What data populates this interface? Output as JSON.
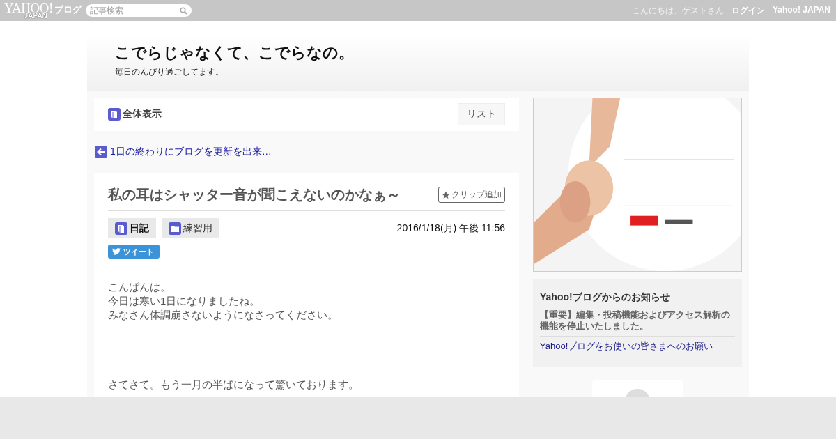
{
  "top_bar": {
    "logo": {
      "wordmark": "YAHOO!",
      "sub": "JAPAN",
      "service": "ブログ"
    },
    "search": {
      "placeholder": "記事検索"
    },
    "greeting": "こんにちは、ゲストさん",
    "links": [
      "ログイン",
      "Yahoo! JAPAN"
    ]
  },
  "blog": {
    "title": "こでらじゃなくて、こでらなの。",
    "subtitle": "毎日のんびり過ごしてます。"
  },
  "view_bar": {
    "label": "全体表示",
    "list_button": "リスト"
  },
  "prev_link": "1日の終わりにブログを更新を出来…",
  "article": {
    "title": "私の耳はシャッター音が聞こえないのかなぁ～",
    "clip_button": "クリップ追加",
    "tags": [
      {
        "kind": "book",
        "label": "日記"
      },
      {
        "kind": "folder",
        "label": "練習用"
      }
    ],
    "date": "2016/1/18(月) 午後 11:56",
    "tweet": "ツイート",
    "paragraphs": [
      [
        "こんばんは。",
        "今日は寒い1日になりましたね。",
        "みなさん体調崩さないようになさってください。"
      ],
      [
        "さてさて。もう一月の半ばになって驚いております。"
      ]
    ]
  },
  "sidebar": {
    "notice": {
      "title": "Yahoo!ブログからのお知らせ",
      "items": [
        {
          "kind": "important",
          "text": "【重要】編集・投稿機能およびアクセス解析の機能を停止いたしました。"
        },
        {
          "kind": "link",
          "text": "Yahoo!ブログをお使いの皆さまへのお願い"
        }
      ]
    }
  }
}
